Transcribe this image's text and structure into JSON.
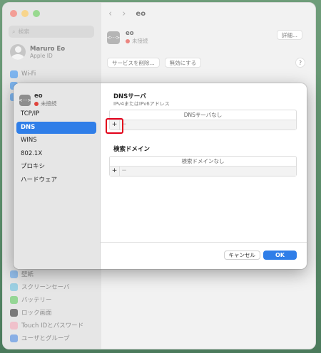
{
  "window": {
    "search_placeholder": "検索",
    "user": {
      "name": "Maruro Eo",
      "sub": "Apple ID"
    },
    "sidebar_top": [
      {
        "label": "Wi-Fi",
        "color": "#3a8ee6"
      },
      {
        "label": "",
        "color": "#3a8ee6"
      },
      {
        "label": "",
        "color": "#3a8ee6"
      }
    ],
    "sidebar_bottom": [
      {
        "label": "壁紙",
        "color": "#5a9be0"
      },
      {
        "label": "スクリーンセーバ",
        "color": "#68b7d4"
      },
      {
        "label": "バッテリー",
        "color": "#5cc05c"
      },
      {
        "label": "ロック画面",
        "color": "#333333"
      },
      {
        "label": "Touch IDとパスワード",
        "color": "#e8a0b0"
      },
      {
        "label": "ユーザとグループ",
        "color": "#4a84d8"
      }
    ],
    "header_title": "eo",
    "service": {
      "name": "eo",
      "status": "未接続",
      "icon": "<···>"
    },
    "detail_button": "詳細...",
    "remove_service_button": "サービスを削除...",
    "disable_button": "無効にする",
    "help_button": "?"
  },
  "sheet": {
    "service": {
      "name": "eo",
      "status": "未接続",
      "icon": "<···>"
    },
    "tabs": [
      "TCP/IP",
      "DNS",
      "WINS",
      "802.1X",
      "プロキシ",
      "ハードウェア"
    ],
    "active_tab": "DNS",
    "dns": {
      "title": "DNSサーバ",
      "subtitle": "IPv4またはIPv6アドレス",
      "empty": "DNSサーバなし"
    },
    "search_domains": {
      "title": "検索ドメイン",
      "empty": "検索ドメインなし"
    },
    "add_button": "+",
    "remove_button": "−",
    "cancel_button": "キャンセル",
    "ok_button": "OK"
  },
  "colors": {
    "accent": "#2f7ee8",
    "highlight": "#e2001a",
    "status_red": "#e0443c"
  }
}
